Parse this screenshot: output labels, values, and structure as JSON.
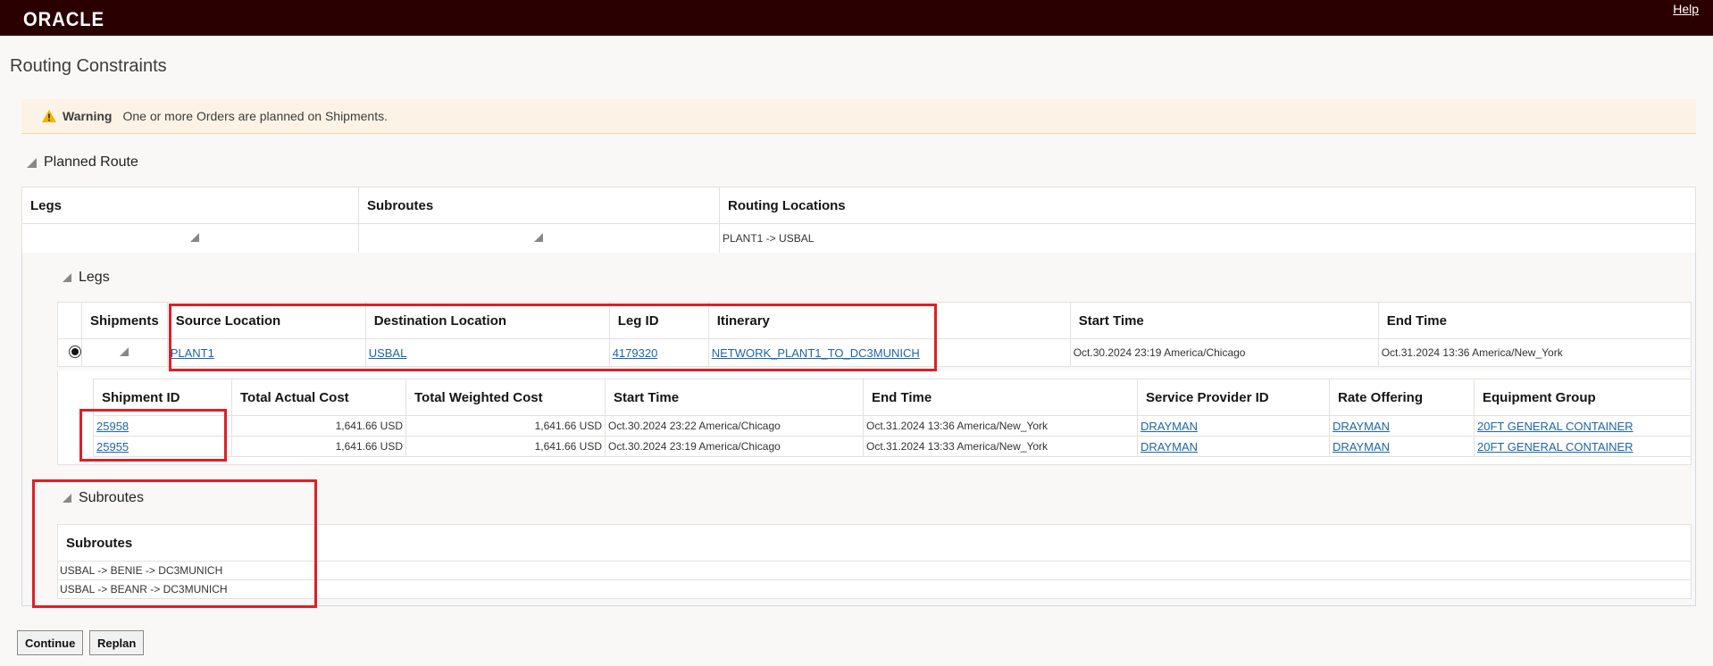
{
  "header": {
    "logo": "ORACLE",
    "help": "Help"
  },
  "page": {
    "title": "Routing Constraints"
  },
  "warning": {
    "label": "Warning",
    "message": "One or more Orders are planned on Shipments."
  },
  "planned_route": {
    "title": "Planned Route",
    "columns": [
      "Legs",
      "Subroutes",
      "Routing Locations"
    ],
    "row": {
      "routing_locations": "PLANT1 -> USBAL"
    }
  },
  "legs": {
    "title": "Legs",
    "columns": [
      "Shipments",
      "Source Location",
      "Destination Location",
      "Leg ID",
      "Itinerary",
      "Start Time",
      "End Time"
    ],
    "row": {
      "source": "PLANT1",
      "destination": "USBAL",
      "leg_id": "4179320",
      "itinerary": "NETWORK_PLANT1_TO_DC3MUNICH",
      "start": "Oct.30.2024 23:19 America/Chicago",
      "end": "Oct.31.2024 13:36 America/New_York"
    }
  },
  "shipments": {
    "columns": [
      "Shipment ID",
      "Total Actual Cost",
      "Total Weighted Cost",
      "Start Time",
      "End Time",
      "Service Provider ID",
      "Rate Offering",
      "Equipment Group"
    ],
    "rows": [
      [
        "25958",
        "1,641.66 USD",
        "1,641.66 USD",
        "Oct.30.2024 23:22 America/Chicago",
        "Oct.31.2024 13:36 America/New_York",
        "DRAYMAN",
        "DRAYMAN",
        "20FT GENERAL CONTAINER"
      ],
      [
        "25955",
        "1,641.66 USD",
        "1,641.66 USD",
        "Oct.30.2024 23:19 America/Chicago",
        "Oct.31.2024 13:33 America/New_York",
        "DRAYMAN",
        "DRAYMAN",
        "20FT GENERAL CONTAINER"
      ]
    ]
  },
  "subroutes": {
    "title": "Subroutes",
    "column": "Subroutes",
    "rows": [
      "USBAL -> BENIE -> DC3MUNICH",
      "USBAL -> BEANR -> DC3MUNICH"
    ]
  },
  "buttons": {
    "continue": "Continue",
    "replan": "Replan"
  },
  "colors": {
    "header_bg": "#2b0001",
    "link": "#1b66a9",
    "highlight": "#e01e26",
    "warning_bg": "#fcf3e6"
  }
}
